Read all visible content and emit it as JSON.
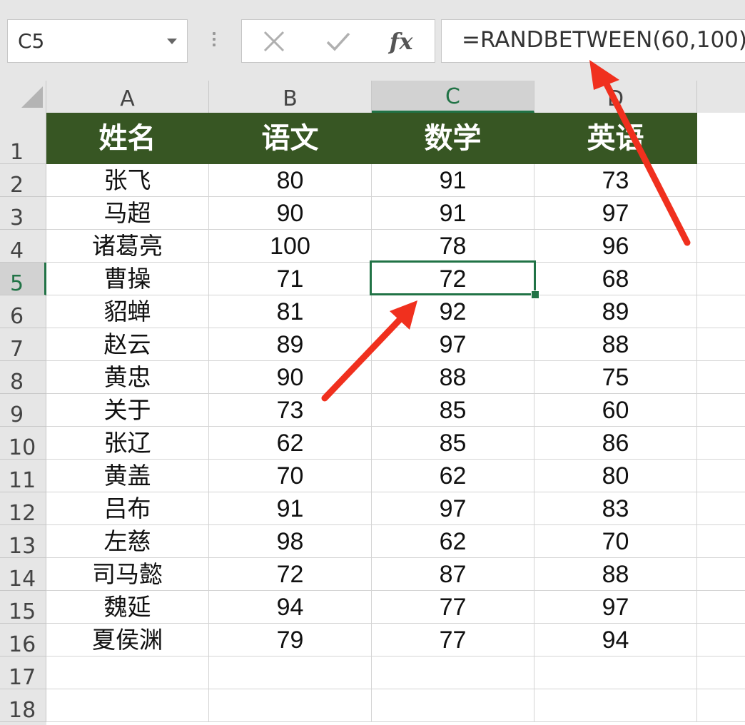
{
  "formula_bar": {
    "name_box": "C5",
    "formula": "=RANDBETWEEN(60,100)",
    "fx_label": "fx"
  },
  "columns": [
    "A",
    "B",
    "C",
    "D"
  ],
  "selected_column": "C",
  "rows": [
    "1",
    "2",
    "3",
    "4",
    "5",
    "6",
    "7",
    "8",
    "9",
    "10",
    "11",
    "12",
    "13",
    "14",
    "15",
    "16",
    "17",
    "18"
  ],
  "selected_row": "5",
  "header_row": [
    "姓名",
    "语文",
    "数学",
    "英语"
  ],
  "table": [
    [
      "张飞",
      "80",
      "91",
      "73"
    ],
    [
      "马超",
      "90",
      "91",
      "97"
    ],
    [
      "诸葛亮",
      "100",
      "78",
      "96"
    ],
    [
      "曹操",
      "71",
      "72",
      "68"
    ],
    [
      "貂蝉",
      "81",
      "92",
      "89"
    ],
    [
      "赵云",
      "89",
      "97",
      "88"
    ],
    [
      "黄忠",
      "90",
      "88",
      "75"
    ],
    [
      "关于",
      "73",
      "85",
      "60"
    ],
    [
      "张辽",
      "62",
      "85",
      "86"
    ],
    [
      "黄盖",
      "70",
      "62",
      "80"
    ],
    [
      "吕布",
      "91",
      "97",
      "83"
    ],
    [
      "左慈",
      "98",
      "62",
      "70"
    ],
    [
      "司马懿",
      "72",
      "87",
      "88"
    ],
    [
      "魏延",
      "94",
      "77",
      "97"
    ],
    [
      "夏侯渊",
      "79",
      "77",
      "94"
    ]
  ],
  "colors": {
    "header_fill": "#375623",
    "selection": "#217346",
    "arrow": "#f0301e"
  }
}
